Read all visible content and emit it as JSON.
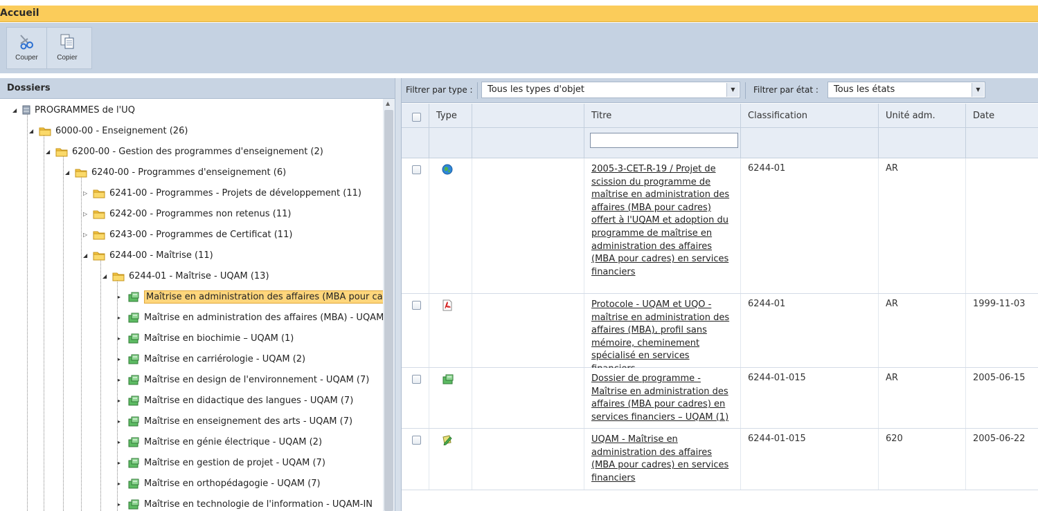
{
  "titlebar": {
    "title": "Accueil"
  },
  "toolbar": {
    "buttons": [
      {
        "label": "Couper",
        "icon": "scissors-icon"
      },
      {
        "label": "Copier",
        "icon": "copy-icon"
      }
    ]
  },
  "folders": {
    "header": "Dossiers",
    "tree": [
      {
        "label": "PROGRAMMES de l'UQ",
        "icon": "database-icon"
      },
      {
        "label": "6000-00 - Enseignement (26)",
        "icon": "folder-icon"
      },
      {
        "label": "6200-00 - Gestion des programmes d'enseignement (2)",
        "icon": "folder-icon"
      },
      {
        "label": "6240-00 - Programmes d'enseignement (6)",
        "icon": "folder-icon"
      },
      {
        "label": "6241-00 - Programmes - Projets de développement (11)",
        "icon": "folder-icon"
      },
      {
        "label": "6242-00 - Programmes non retenus (11)",
        "icon": "folder-icon"
      },
      {
        "label": "6243-00 - Programmes de Certificat (11)",
        "icon": "folder-icon"
      },
      {
        "label": "6244-00 - Maîtrise (11)",
        "icon": "folder-icon"
      },
      {
        "label": "6244-01 - Maîtrise - UQAM (13)",
        "icon": "folder-icon"
      },
      {
        "label": "Maîtrise en administration des affaires (MBA pour ca",
        "icon": "green-folder-icon",
        "selected": true
      },
      {
        "label": "Maîtrise en administration des affaires (MBA) - UQAM",
        "icon": "green-folder-icon"
      },
      {
        "label": "Maîtrise en biochimie – UQAM (1)",
        "icon": "green-folder-icon"
      },
      {
        "label": "Maîtrise en carriérologie - UQAM (2)",
        "icon": "green-folder-icon"
      },
      {
        "label": "Maîtrise en design de l'environnement - UQAM (7)",
        "icon": "green-folder-icon"
      },
      {
        "label": "Maîtrise en didactique des langues - UQAM (7)",
        "icon": "green-folder-icon"
      },
      {
        "label": "Maîtrise en enseignement des arts - UQAM (7)",
        "icon": "green-folder-icon"
      },
      {
        "label": "Maîtrise en génie électrique - UQAM (2)",
        "icon": "green-folder-icon"
      },
      {
        "label": "Maîtrise en gestion de projet - UQAM (7)",
        "icon": "green-folder-icon"
      },
      {
        "label": "Maîtrise en orthopédagogie - UQAM (7)",
        "icon": "green-folder-icon"
      },
      {
        "label": "Maîtrise en technologie de l'information - UQAM-IN",
        "icon": "green-folder-icon"
      }
    ]
  },
  "filters": {
    "type_label": "Filtrer par type :",
    "type_value": "Tous les types d'objet",
    "state_label": "Filtrer par état :",
    "state_value": "Tous les états"
  },
  "grid": {
    "columns": [
      "Type",
      "Titre",
      "Classification",
      "Unité adm.",
      "Date"
    ],
    "rows": [
      {
        "icon": "globe-icon",
        "title": "2005-3-CET-R-19 / Projet de scission du programme de maîtrise en administration des affaires (MBA pour cadres) offert à l'UQAM et adoption du programme de maîtrise en administration des affaires (MBA pour cadres) en services financiers",
        "classification": "6244-01",
        "unit": "AR",
        "date": ""
      },
      {
        "icon": "pdf-icon",
        "title": "Protocole - UQAM et UQO - maîtrise en administration des affaires (MBA), profil sans mémoire, cheminement spécialisé en services financiers",
        "classification": "6244-01",
        "unit": "AR",
        "date": "1999-11-03"
      },
      {
        "icon": "green-folder-icon",
        "title": "Dossier de programme - Maîtrise en administration des affaires (MBA pour cadres) en services financiers – UQAM (1)",
        "classification": "6244-01-015",
        "unit": "AR",
        "date": "2005-06-15"
      },
      {
        "icon": "edit-document-icon",
        "title": "UQAM - Maîtrise en administration des affaires (MBA pour cadres) en services financiers",
        "classification": "6244-01-015",
        "unit": "620",
        "date": "2005-06-22"
      }
    ]
  }
}
